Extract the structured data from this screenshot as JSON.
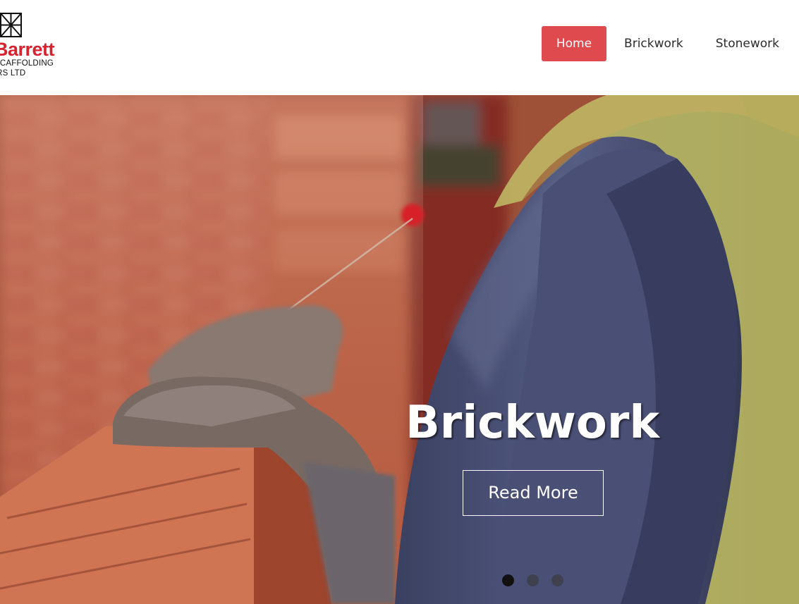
{
  "brand": {
    "name": "Barrett",
    "line1": "SCAFFOLDING",
    "line2": "ORS LTD",
    "accent_color": "#d7232f",
    "mark_icon": "scaffold-grid-icon"
  },
  "nav": {
    "items": [
      {
        "label": "Home",
        "active": true
      },
      {
        "label": "Brickwork",
        "active": false
      },
      {
        "label": "Stonework",
        "active": false
      }
    ],
    "active_color": "#df4a4f"
  },
  "hero": {
    "title": "Brickwork",
    "button_label": "Read More",
    "slides_total": 3,
    "active_slide": 1,
    "image_description_icon": "bricklayer-photo"
  }
}
